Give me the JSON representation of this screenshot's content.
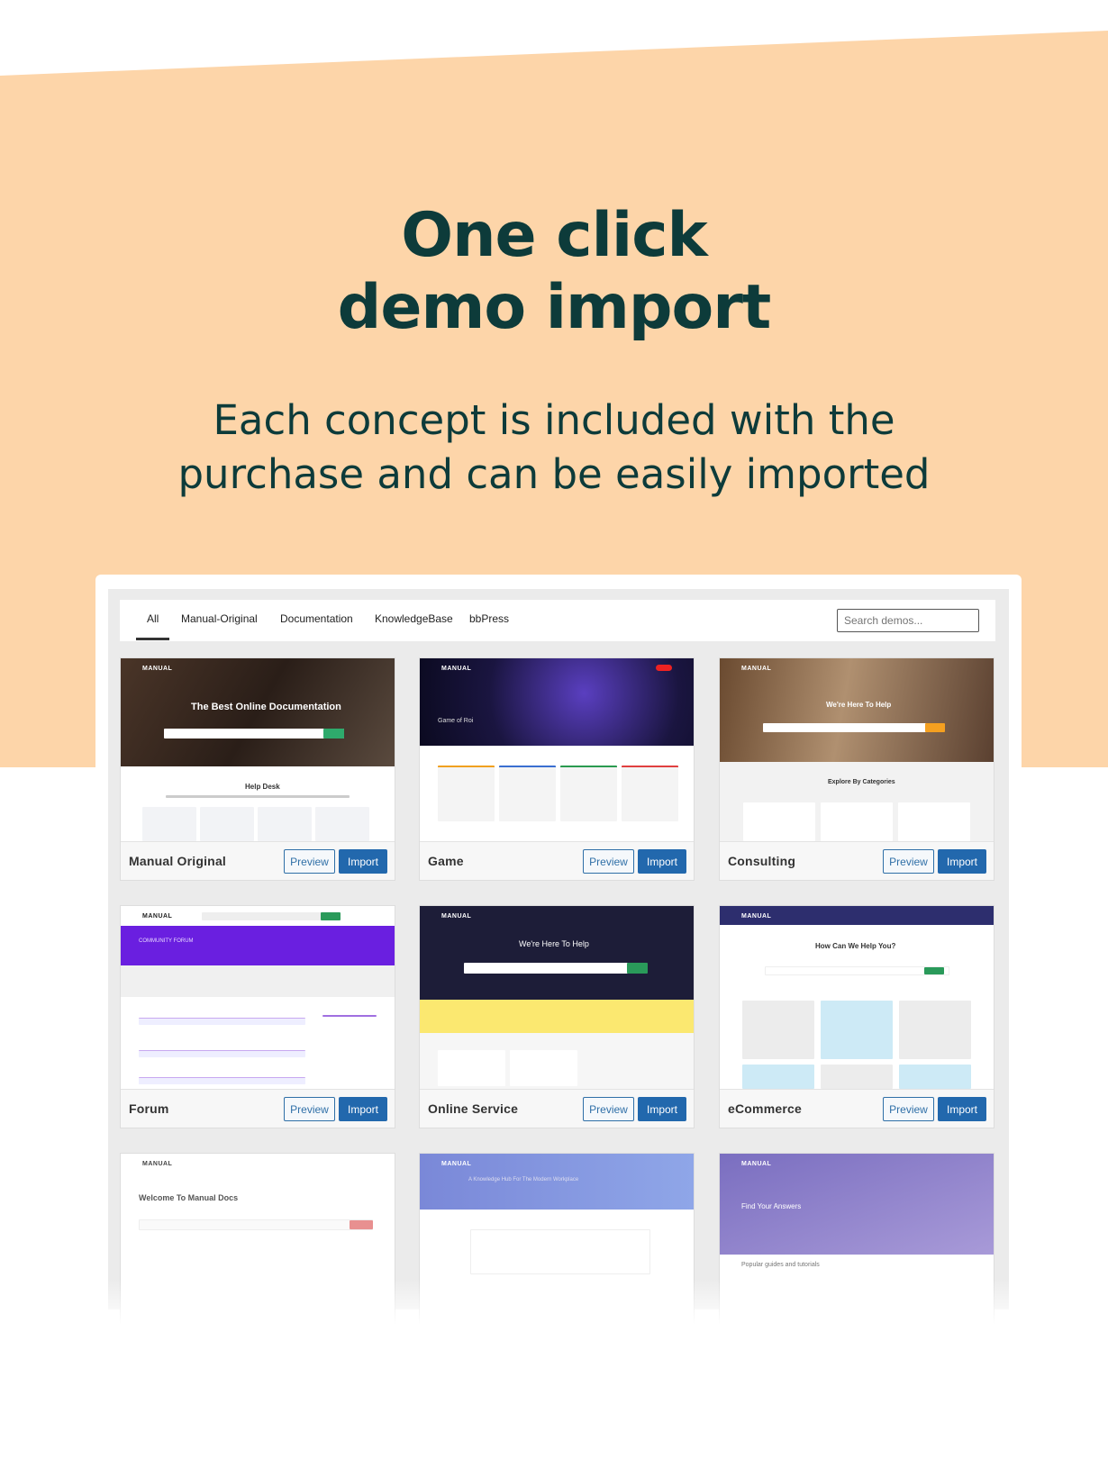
{
  "colors": {
    "band": "#fdd5a9",
    "heading": "#0d3b3a",
    "import_button": "#2268ad",
    "preview_border": "#2f6fa7"
  },
  "hero": {
    "title_line1": "One click",
    "title_line2": "demo import",
    "subtitle_line1": "Each concept is included with the",
    "subtitle_line2": "purchase and can be easily imported"
  },
  "filters": {
    "tabs": [
      {
        "label": "All",
        "active": true
      },
      {
        "label": "Manual-Original"
      },
      {
        "label": "Documentation"
      },
      {
        "label": "KnowledgeBase"
      },
      {
        "label": "bbPress"
      }
    ],
    "search_placeholder": "Search demos..."
  },
  "demos": [
    {
      "name": "Manual Original",
      "preview": "Preview",
      "import": "Import",
      "thumb": {
        "logo": "MANUAL",
        "headline": "The Best Online Documentation",
        "section": "Help Desk"
      }
    },
    {
      "name": "Game",
      "preview": "Preview",
      "import": "Import",
      "thumb": {
        "logo": "MANUAL",
        "headline": "Game of Roi"
      }
    },
    {
      "name": "Consulting",
      "preview": "Preview",
      "import": "Import",
      "thumb": {
        "logo": "MANUAL",
        "headline": "We're Here To Help",
        "section": "Explore By Categories"
      }
    },
    {
      "name": "Forum",
      "preview": "Preview",
      "import": "Import",
      "thumb": {
        "logo": "MANUAL",
        "headline": "COMMUNITY FORUM"
      }
    },
    {
      "name": "Online Service",
      "preview": "Preview",
      "import": "Import",
      "thumb": {
        "logo": "MANUAL",
        "headline": "We're Here To Help"
      }
    },
    {
      "name": "eCommerce",
      "preview": "Preview",
      "import": "Import",
      "thumb": {
        "logo": "MANUAL",
        "headline": "How Can We Help You?"
      }
    },
    {
      "name": "",
      "thumb": {
        "logo": "MANUAL",
        "headline": "Welcome To Manual Docs"
      }
    },
    {
      "name": "",
      "thumb": {
        "logo": "MANUAL",
        "headline": "A Knowledge Hub For The Modern Workplace"
      }
    },
    {
      "name": "",
      "thumb": {
        "logo": "MANUAL",
        "headline": "Find Your Answers",
        "section": "Popular guides and tutorials"
      }
    }
  ]
}
